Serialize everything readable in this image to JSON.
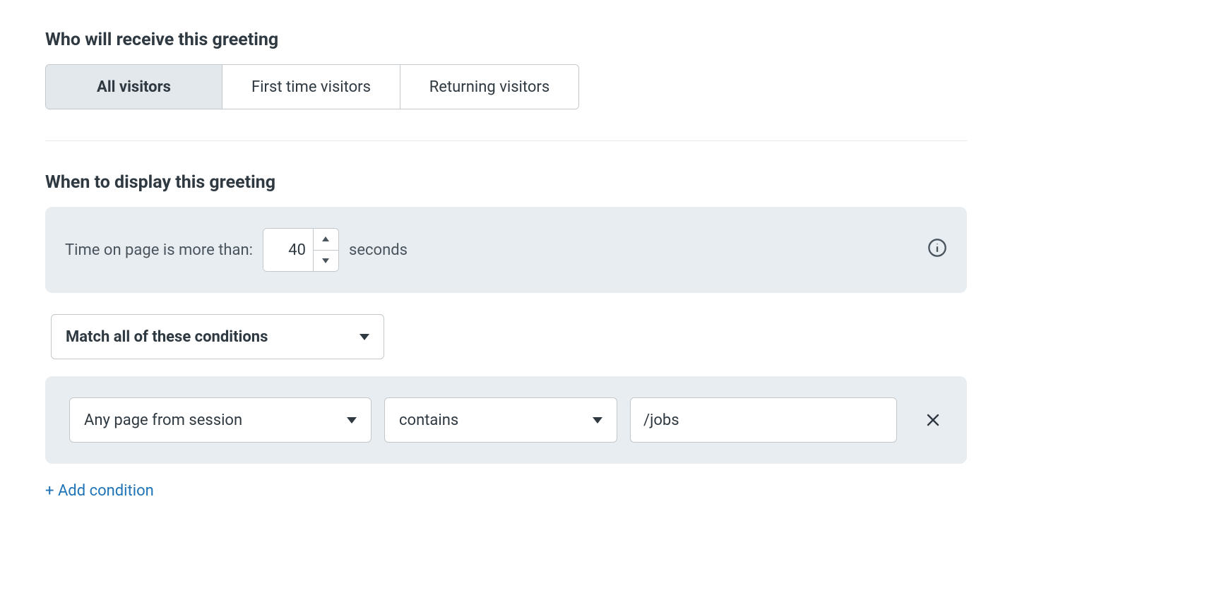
{
  "sections": {
    "who": {
      "title": "Who will receive this greeting",
      "tabs": {
        "all": "All visitors",
        "first": "First time visitors",
        "returning": "Returning visitors"
      }
    },
    "when": {
      "title": "When to display this greeting",
      "time_label": "Time on page is more than:",
      "time_value": "40",
      "time_units": "seconds",
      "match_mode": "Match all of these conditions",
      "condition": {
        "field": "Any page from session",
        "operator": "contains",
        "value": "/jobs"
      },
      "add_condition": "+ Add condition"
    }
  }
}
